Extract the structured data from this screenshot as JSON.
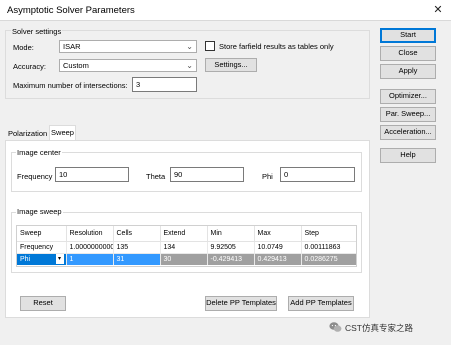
{
  "window": {
    "title": "Asymptotic Solver Parameters",
    "close_glyph": "✕"
  },
  "solver_settings": {
    "group_label": "Solver settings",
    "mode_label": "Mode:",
    "mode_value": "ISAR",
    "accuracy_label": "Accuracy:",
    "accuracy_value": "Custom",
    "store_farfield_label": "Store farfield results as tables only",
    "store_farfield_checked": false,
    "settings_button": "Settings...",
    "max_intersections_label": "Maximum number of intersections:",
    "max_intersections_value": "3"
  },
  "right_buttons": {
    "start": "Start",
    "close": "Close",
    "apply": "Apply",
    "optimizer": "Optimizer...",
    "par_sweep": "Par. Sweep...",
    "acceleration": "Acceleration...",
    "help": "Help"
  },
  "tabs": [
    {
      "label": "Polarization",
      "active": false
    },
    {
      "label": "Sweep",
      "active": true
    }
  ],
  "image_center": {
    "group_label": "Image center",
    "frequency_label": "Frequency",
    "frequency_value": "10",
    "theta_label": "Theta",
    "theta_value": "90",
    "phi_label": "Phi",
    "phi_value": "0"
  },
  "image_sweep": {
    "group_label": "Image sweep",
    "columns": [
      "Sweep",
      "Resolution",
      "Cells",
      "Extend",
      "Min",
      "Max",
      "Step"
    ],
    "rows": [
      [
        "Frequency",
        "1.0000000000(",
        "135",
        "134",
        "9.92505",
        "10.0749",
        "0.00111863"
      ],
      [
        "Phi",
        "1",
        "31",
        "30",
        "-0.429413",
        "0.429413",
        "0.0286275"
      ]
    ]
  },
  "bottom_buttons": {
    "reset": "Reset",
    "delete_pp": "Delete PP Templates",
    "add_pp": "Add PP Templates"
  },
  "watermark": {
    "text": "CST仿真专家之路"
  }
}
